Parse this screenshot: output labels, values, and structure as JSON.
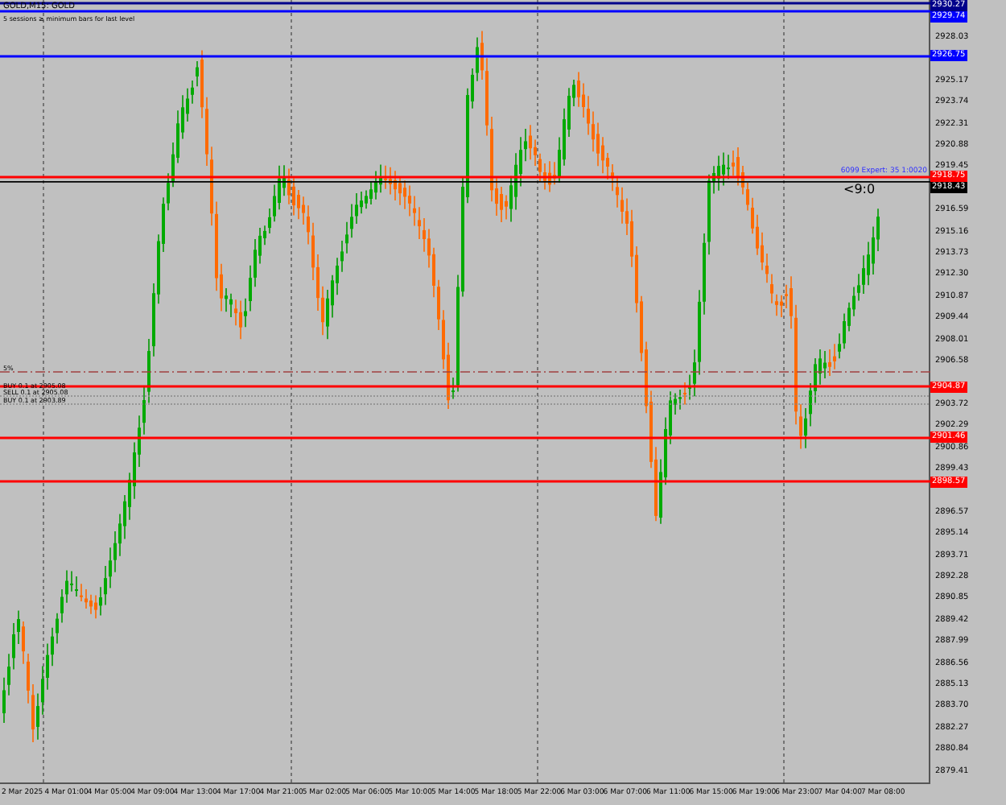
{
  "chart": {
    "title": "GOLD,M15: GOLD",
    "subtitle": "5 sessions ≥ minimum bars for last level",
    "annotation": "<9:0",
    "expert_label": "6099 Expert: 35 1:0020"
  },
  "price_axis": {
    "ticks": [
      "2928.03",
      "2925.17",
      "2923.74",
      "2922.31",
      "2920.88",
      "2919.45",
      "2916.59",
      "2915.16",
      "2913.73",
      "2912.30",
      "2910.87",
      "2909.44",
      "2908.01",
      "2906.58",
      "2903.72",
      "2902.29",
      "2900.86",
      "2899.43",
      "2896.57",
      "2895.14",
      "2893.71",
      "2892.28",
      "2890.85",
      "2889.42",
      "2887.99",
      "2886.56",
      "2885.13",
      "2883.70",
      "2882.27",
      "2880.84",
      "2879.41"
    ]
  },
  "levels": [
    {
      "price": "2930.27",
      "color": "#00008b"
    },
    {
      "price": "2929.74",
      "color": "#0000ff"
    },
    {
      "price": "2926.75",
      "color": "#0000ff"
    },
    {
      "price": "2918.75",
      "color": "#ff0000"
    },
    {
      "price": "2918.43",
      "color": "#000000"
    },
    {
      "price": "2904.87",
      "color": "#ff0000"
    },
    {
      "price": "2901.46",
      "color": "#ff0000"
    },
    {
      "price": "2898.57",
      "color": "#ff0000"
    }
  ],
  "orders": [
    {
      "text": "5%",
      "kind": "dashdot"
    },
    {
      "text": "BUY 0.1 at 2905.08",
      "kind": "plain"
    },
    {
      "text": "SELL 0.1 at 2905.08",
      "kind": "dotted"
    },
    {
      "text": "BUY 0.1 at 2903.89",
      "kind": "dotted"
    }
  ],
  "time_axis": [
    "2 Mar 2025",
    "4 Mar 01:00",
    "4 Mar 05:00",
    "4 Mar 09:00",
    "4 Mar 13:00",
    "4 Mar 17:00",
    "4 Mar 21:00",
    "5 Mar 02:00",
    "5 Mar 06:00",
    "5 Mar 10:00",
    "5 Mar 14:00",
    "5 Mar 18:00",
    "5 Mar 22:00",
    "6 Mar 03:00",
    "6 Mar 07:00",
    "6 Mar 11:00",
    "6 Mar 15:00",
    "6 Mar 19:00",
    "6 Mar 23:00",
    "7 Mar 04:00",
    "7 Mar 08:00"
  ]
}
